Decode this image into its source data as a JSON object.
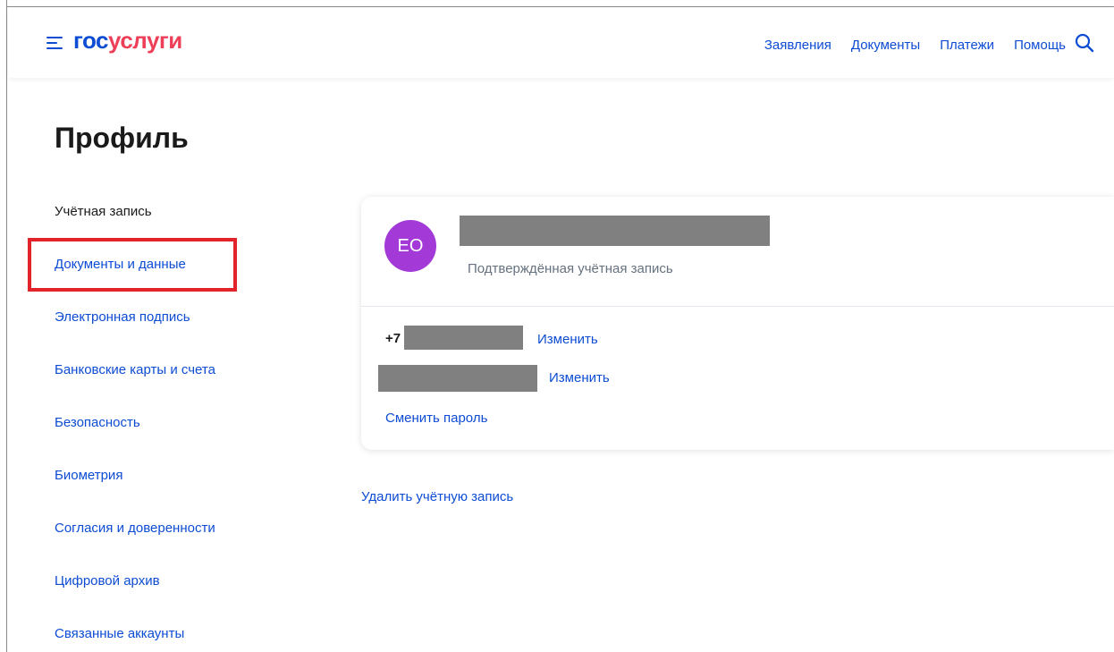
{
  "header": {
    "logo_part1": "гос",
    "logo_part2": "услуги",
    "nav": [
      "Заявления",
      "Документы",
      "Платежи",
      "Помощь"
    ]
  },
  "page": {
    "title": "Профиль"
  },
  "sidebar": {
    "items": [
      {
        "label": "Учётная запись"
      },
      {
        "label": "Документы и данные"
      },
      {
        "label": "Электронная подпись"
      },
      {
        "label": "Банковские карты и счета"
      },
      {
        "label": "Безопасность"
      },
      {
        "label": "Биометрия"
      },
      {
        "label": "Согласия и доверенности"
      },
      {
        "label": "Цифровой архив"
      },
      {
        "label": "Связанные аккаунты"
      }
    ]
  },
  "profile": {
    "avatar_initials": "ЕО",
    "account_status": "Подтверждённая учётная запись",
    "phone_prefix": "+7",
    "change_phone": "Изменить",
    "change_email": "Изменить",
    "change_password": "Сменить пароль",
    "delete_account": "Удалить учётную запись"
  },
  "colors": {
    "accent": "#0d4cd3",
    "logo_red": "#ee3f58",
    "avatar": "#a33ad8",
    "highlight": "#e2232a"
  }
}
